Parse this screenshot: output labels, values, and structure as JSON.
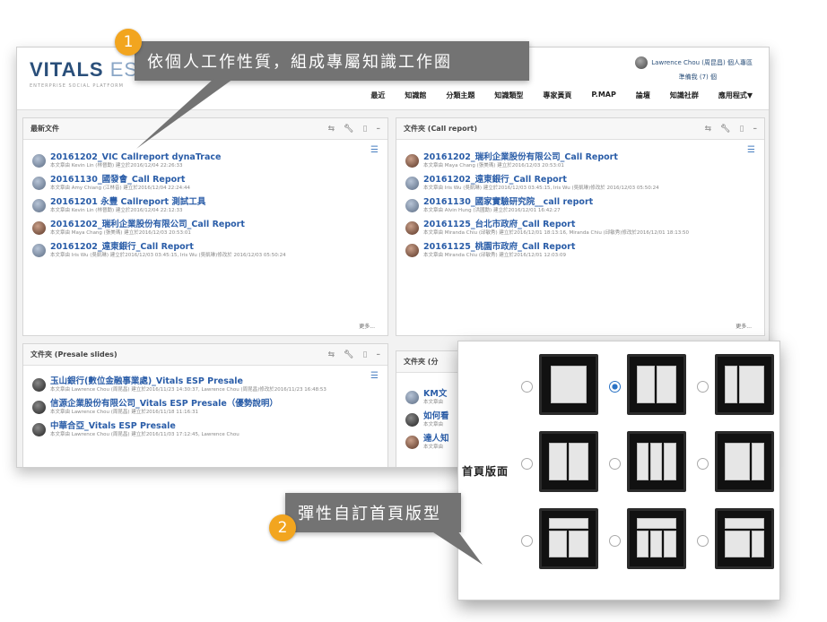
{
  "header": {
    "logo_main": "VITALS",
    "logo_sub": "ESP",
    "tagline": "ENTERPRISE SOCIAL PLATFORM",
    "user_name": "Lawrence Chou (周昆昌) 個人專區",
    "user_sub": "準備我 (7) 個",
    "nav": [
      "最近",
      "知識館",
      "分類主題",
      "知識類型",
      "專家黃頁",
      "P.MAP",
      "論壇",
      "知識社群",
      "應用程式▼"
    ]
  },
  "callouts": {
    "c1_number": "1",
    "c1_text": "依個人工作性質，組成專屬知識工作圈",
    "c2_number": "2",
    "c2_text": "彈性自訂首頁版型"
  },
  "panels": {
    "latest": {
      "title": "最新文件",
      "more": "更多...",
      "items": [
        {
          "title": "20161202_VIC Callreport dynaTrace",
          "meta": "本文章由 Kevin Lin (林晉勳) 建立於2016/12/04 22:26:33"
        },
        {
          "title": "20161130_國發會_Call Report",
          "meta": "本文章由 Amy Chiang (江林音) 建立於2016/12/04 22:24:44"
        },
        {
          "title": "20161201 永豐 Callreport 測試工具",
          "meta": "本文章由 Kevin Lin (林晉勳) 建立於2016/12/04 22:12:33"
        },
        {
          "title": "20161202_瑞利企業股份有限公司_Call Report",
          "meta": "本文章由 Maya Chang (張美瑪) 建立於2016/12/03 20:53:01"
        },
        {
          "title": "20161202_遠東銀行_Call Report",
          "meta": "本文章由 Iris Wu (吳凱琳) 建立於2016/12/03 03:45:15, Iris Wu (吳凱琳)修改於 2016/12/03 05:50:24"
        }
      ]
    },
    "callreport": {
      "title": "文件夾 (Call report)",
      "more": "更多...",
      "items": [
        {
          "title": "20161202_瑞利企業股份有限公司_Call Report",
          "meta": "本文章由 Maya Chang (張美瑪) 建立於2016/12/03 20:53:01"
        },
        {
          "title": "20161202_遠東銀行_Call Report",
          "meta": "本文章由 Iris Wu (吳凱琳) 建立於2016/12/03 03:45:15, Iris Wu (吳凱琳)修改於 2016/12/03 05:50:24"
        },
        {
          "title": "20161130_國家實驗研究院__call report",
          "meta": "本文章由 Alvin Hung (洪國勳) 建立於2016/12/01 16:42:27"
        },
        {
          "title": "20161125_台北市政府_Call Report",
          "meta": "本文章由 Miranda Chiu (邱敏秀) 建立於2016/12/01 18:13:16, Miranda Chiu (邱敏秀)修改於2016/12/01 18:13:50"
        },
        {
          "title": "20161125_桃園市政府_Call Report",
          "meta": "本文章由 Miranda Chiu (邱敏秀) 建立於2016/12/01 12:03:09"
        }
      ]
    },
    "presale": {
      "title": "文件夾 (Presale slides)",
      "items": [
        {
          "title": "玉山銀行(數位金融事業處)_Vitals ESP Presale",
          "meta": "本文章由 Lawrence Chou (周昆昌) 建立於2016/11/23 14:30:37, Lawrence Chou (周昆昌)修改於2016/11/23 16:48:53"
        },
        {
          "title": "信源企業股份有限公司_Vitals ESP Presale（優勢說明）",
          "meta": "本文章由 Lawrence Chou (周昆昌) 建立於2016/11/18 11:16:31"
        },
        {
          "title": "中華合亞_Vitals ESP Presale",
          "meta": "本文章由 Lawrence Chou (周昆昌) 建立於2016/11/03 17:12:45, Lawrence Chou"
        }
      ]
    },
    "partial": {
      "title": "文件夾 (分",
      "items": [
        {
          "title": "KM文",
          "meta": "本文章由"
        },
        {
          "title": "如何看",
          "meta": "本文章由"
        },
        {
          "title": "達人知",
          "meta": "本文章由"
        }
      ]
    }
  },
  "picker": {
    "label": "首頁版面",
    "selected": 1
  }
}
